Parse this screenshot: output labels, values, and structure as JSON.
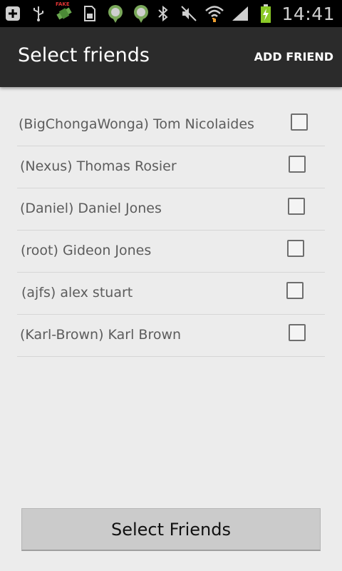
{
  "status_bar": {
    "time": "14:41",
    "icons": [
      "add-icon",
      "usb-icon",
      "fake-gps-icon",
      "sd-card-icon",
      "location-pin-icon",
      "location-pin-icon",
      "bluetooth-icon",
      "mute-icon",
      "wifi-icon",
      "signal-icon",
      "battery-charging-icon"
    ],
    "fake_label": "FAKE"
  },
  "action_bar": {
    "title": "Select friends",
    "add_friend": "ADD FRIEND"
  },
  "friends": [
    {
      "label": "(BigChongaWonga) Tom Nicolaides",
      "checked": false
    },
    {
      "label": "(Nexus) Thomas Rosier",
      "checked": false
    },
    {
      "label": "(Daniel) Daniel Jones",
      "checked": false
    },
    {
      "label": "(root) Gideon Jones",
      "checked": false
    },
    {
      "label": "(ajfs) alex stuart",
      "checked": false
    },
    {
      "label": "(Karl-Brown) Karl Brown",
      "checked": false
    }
  ],
  "bottom_button": {
    "label": "Select Friends"
  }
}
